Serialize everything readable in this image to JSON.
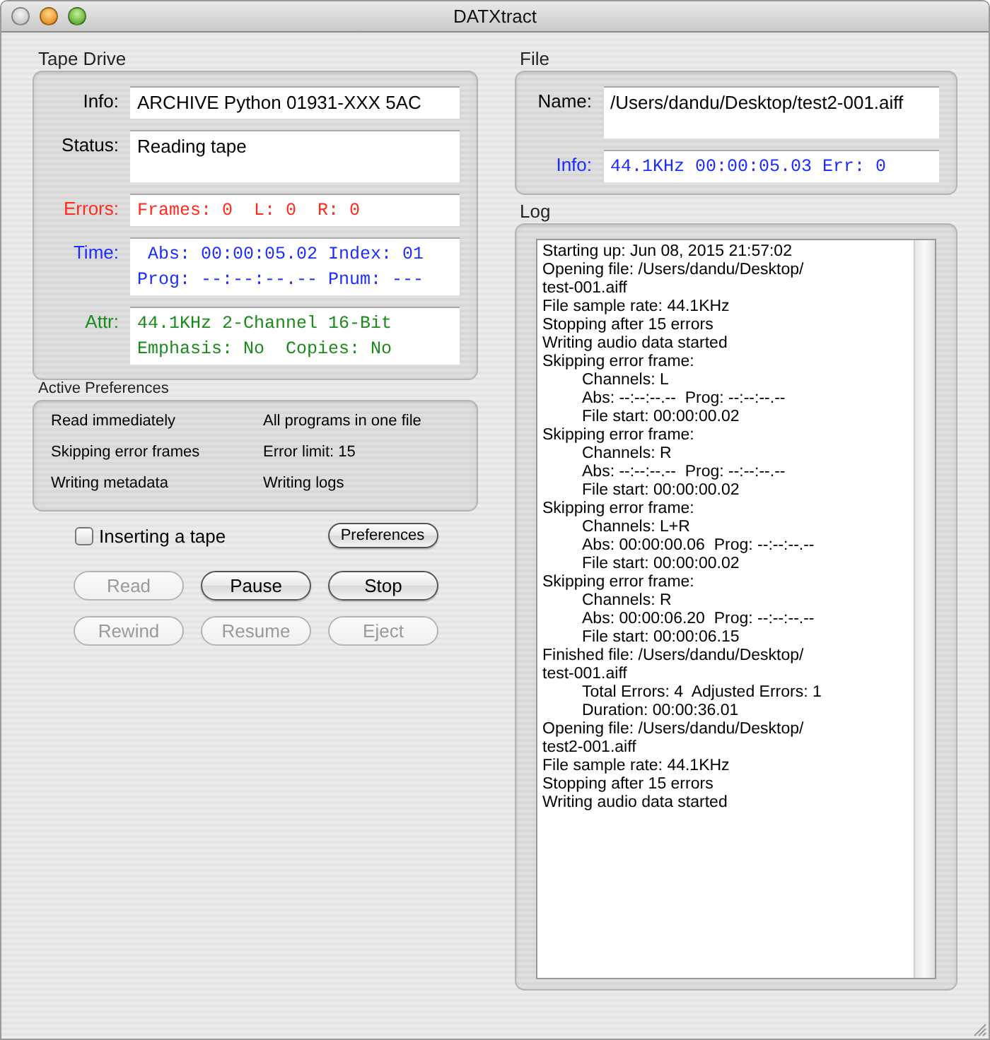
{
  "window": {
    "title": "DATXtract"
  },
  "tape_drive": {
    "title": "Tape Drive",
    "fields": [
      {
        "label": "Info:",
        "kind": "text",
        "lines": [
          "ARCHIVE Python 01931-XXX 5AC"
        ],
        "tall": false
      },
      {
        "label": "Status:",
        "kind": "text",
        "lines": [
          "Reading tape"
        ],
        "tall": true
      },
      {
        "label": "Errors:",
        "kind": "mono",
        "color": "#ff2a1a",
        "lines": [
          "Frames: 0  L: 0  R: 0"
        ],
        "tall": false
      },
      {
        "label": "Time:",
        "kind": "mono",
        "color": "#1a2cff",
        "lines": [
          " Abs: 00:00:05.02 Index: 01",
          "Prog: --:--:--.-- Pnum: ---"
        ],
        "tall": false
      },
      {
        "label": "Attr:",
        "kind": "mono",
        "color": "#1a8a1a",
        "lines": [
          "44.1KHz 2-Channel 16-Bit",
          "Emphasis: No  Copies: No"
        ],
        "tall": false
      }
    ]
  },
  "active_preferences": {
    "title": "Active Preferences",
    "items": [
      "Read immediately",
      "All programs in one file",
      "Skipping error frames",
      "Error limit: 15",
      "Writing metadata",
      "Writing logs"
    ]
  },
  "inserting_tape": {
    "label": "Inserting a tape",
    "checked": false
  },
  "preferences_button": "Preferences",
  "buttons": [
    {
      "label": "Read",
      "disabled": true
    },
    {
      "label": "Pause",
      "disabled": false
    },
    {
      "label": "Stop",
      "disabled": false
    },
    {
      "label": "Rewind",
      "disabled": true
    },
    {
      "label": "Resume",
      "disabled": true
    },
    {
      "label": "Eject",
      "disabled": true
    }
  ],
  "file": {
    "title": "File",
    "fields": [
      {
        "label": "Name:",
        "kind": "text",
        "lines": [
          "/Users/dandu/Desktop/test2-001.aiff"
        ],
        "tall": true
      },
      {
        "label": "Info:",
        "kind": "mono",
        "color": "#1a2cff",
        "lines": [
          "44.1KHz 00:00:05.03 Err: 0"
        ],
        "tall": false
      }
    ]
  },
  "log": {
    "title": "Log",
    "lines": [
      {
        "text": "Starting up: Jun 08, 2015 21:57:02"
      },
      {
        "text": "Opening file: /Users/dandu/Desktop/\ntest-001.aiff"
      },
      {
        "text": "File sample rate: 44.1KHz"
      },
      {
        "text": "Stopping after 15 errors"
      },
      {
        "text": "Writing audio data started"
      },
      {
        "text": "Skipping error frame:",
        "children": [
          {
            "text": "Channels: L"
          },
          {
            "text": "Abs: --:--:--.--  Prog: --:--:--.--"
          },
          {
            "text": "File start: 00:00:00.02"
          }
        ]
      },
      {
        "text": "Skipping error frame:",
        "children": [
          {
            "text": "Channels: R"
          },
          {
            "text": "Abs: --:--:--.--  Prog: --:--:--.--"
          },
          {
            "text": "File start: 00:00:00.02"
          }
        ]
      },
      {
        "text": "Skipping error frame:",
        "children": [
          {
            "text": "Channels: L+R"
          },
          {
            "text": "Abs: 00:00:00.06  Prog: --:--:--.--"
          },
          {
            "text": "File start: 00:00:00.02"
          }
        ]
      },
      {
        "text": "Skipping error frame:",
        "children": [
          {
            "text": "Channels: R"
          },
          {
            "text": "Abs: 00:00:06.20  Prog: --:--:--.--"
          },
          {
            "text": "File start: 00:00:06.15"
          }
        ]
      },
      {
        "text": "Finished file: /Users/dandu/Desktop/\ntest-001.aiff",
        "children": [
          {
            "text": "Total Errors: 4  Adjusted Errors: 1"
          },
          {
            "text": "Duration: 00:00:36.01"
          }
        ]
      },
      {
        "text": "Opening file: /Users/dandu/Desktop/\ntest2-001.aiff"
      },
      {
        "text": "File sample rate: 44.1KHz"
      },
      {
        "text": "Stopping after 15 errors"
      },
      {
        "text": "Writing audio data started"
      }
    ]
  }
}
